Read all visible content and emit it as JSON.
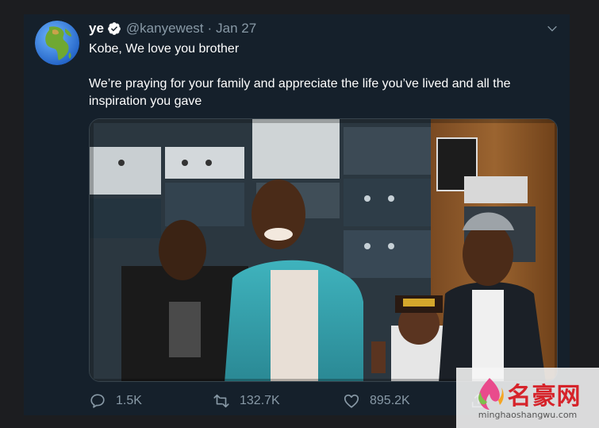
{
  "tweet": {
    "author_name": "ye",
    "handle": "@kanyewest",
    "separator": "·",
    "date": "Jan 27",
    "text_line1": "Kobe, We love you brother",
    "text_line2": "We’re praying for your family and appreciate the life you’ve lived and all the inspiration you gave",
    "avatar_icon": "globe-africa-icon",
    "media_description_icon": "studio-photo"
  },
  "actions": {
    "reply_count": "1.5K",
    "retweet_count": "132.7K",
    "like_count": "895.2K"
  },
  "watermark": {
    "brand_text": "名豪网",
    "url_text": "minghaoshangwu.com"
  },
  "colors": {
    "background": "#15202b",
    "page": "#1c1d20",
    "text_primary": "#ffffff",
    "text_secondary": "#8899a6",
    "border": "#38444d"
  }
}
